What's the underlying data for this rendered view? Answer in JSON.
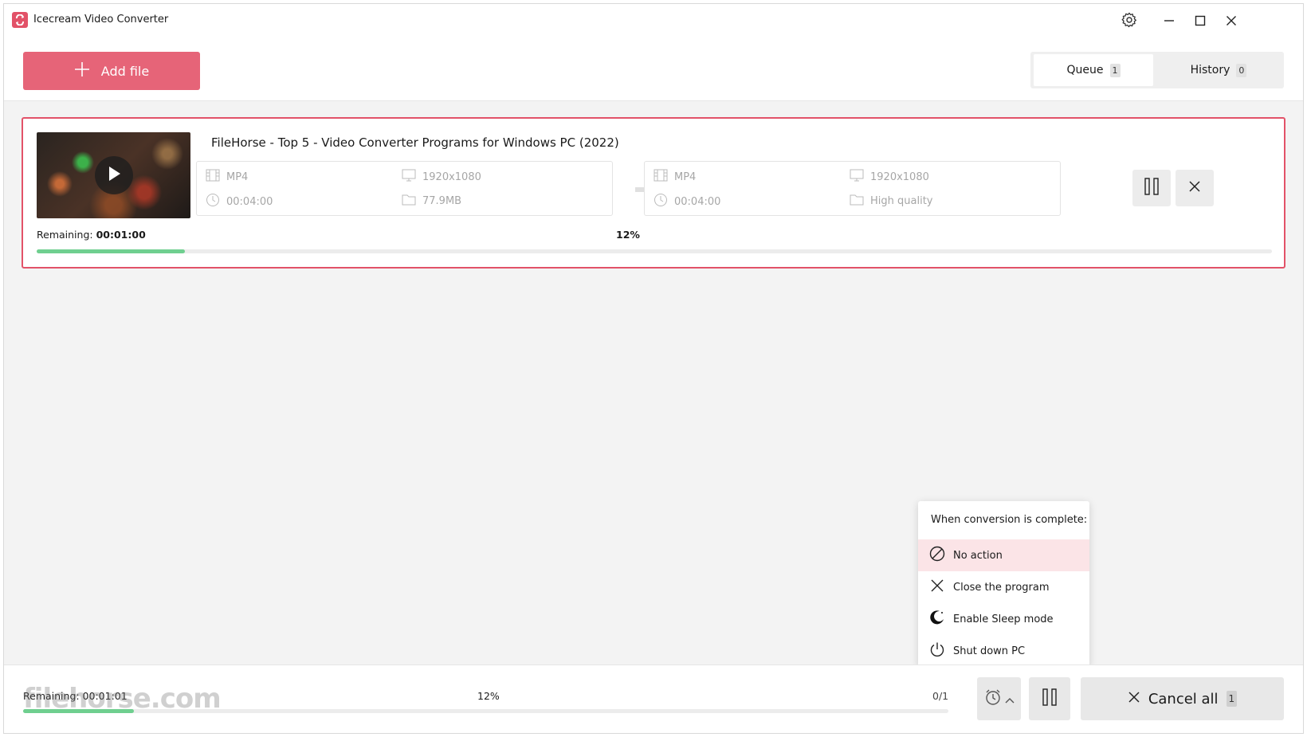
{
  "window": {
    "title": "Icecream Video Converter"
  },
  "header": {
    "add_file_label": "Add file",
    "tabs": [
      {
        "label": "Queue",
        "count": "1",
        "active": true
      },
      {
        "label": "History",
        "count": "0",
        "active": false
      }
    ]
  },
  "queue_item": {
    "title": "FileHorse - Top 5 - Video Converter Programs for Windows PC (2022)",
    "source": {
      "format": "MP4",
      "resolution": "1920x1080",
      "duration": "00:04:00",
      "size": "77.9MB"
    },
    "target": {
      "format": "MP4",
      "resolution": "1920x1080",
      "duration": "00:04:00",
      "quality": "High quality"
    },
    "remaining_label": "Remaining:",
    "remaining_value": "00:01:00",
    "percent": "12%",
    "progress": 0.12
  },
  "completion_menu": {
    "title": "When conversion is complete:",
    "options": [
      {
        "label": "No action",
        "icon": "no-action-icon",
        "selected": true
      },
      {
        "label": "Close the program",
        "icon": "close-icon",
        "selected": false
      },
      {
        "label": "Enable Sleep mode",
        "icon": "moon-icon",
        "selected": false
      },
      {
        "label": "Shut down PC",
        "icon": "power-icon",
        "selected": false
      }
    ]
  },
  "bottom_bar": {
    "remaining": "Remaining: 00:01:01",
    "percent": "12%",
    "count": "0/1",
    "progress": 0.12,
    "cancel_all_label": "Cancel all",
    "cancel_all_count": "1"
  },
  "watermark": "filehorse.com",
  "colors": {
    "accent": "#e66478",
    "border_active": "#e25268",
    "progress": "#6fcf8f",
    "selected_bg": "#fbe4e7"
  }
}
